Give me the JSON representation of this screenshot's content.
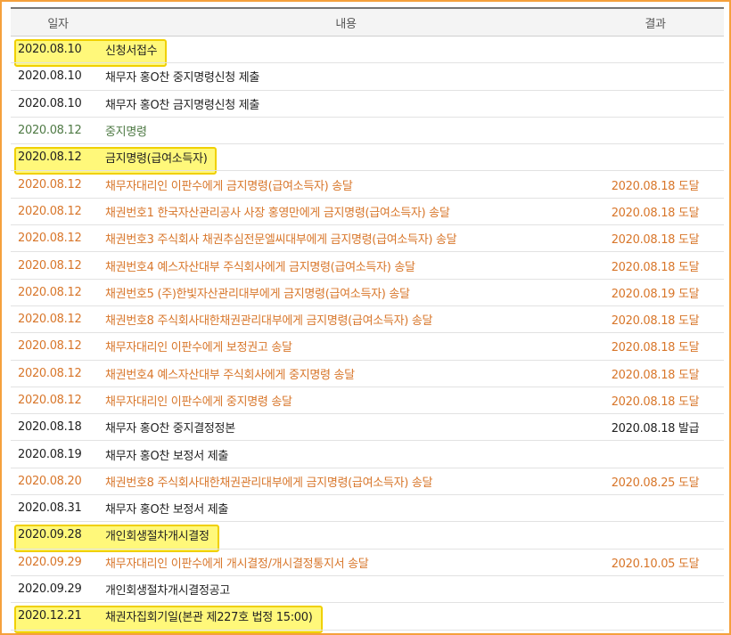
{
  "columns": {
    "date": "일자",
    "content": "내용",
    "result": "결과"
  },
  "rows": [
    {
      "date": "2020.08.10",
      "content": "신청서접수",
      "result": "",
      "style": "hl"
    },
    {
      "date": "2020.08.10",
      "content": "채무자 홍O찬 중지명령신청 제출",
      "result": "",
      "style": "black"
    },
    {
      "date": "2020.08.10",
      "content": "채무자 홍O찬 금지명령신청 제출",
      "result": "",
      "style": "black"
    },
    {
      "date": "2020.08.12",
      "content": "중지명령",
      "result": "",
      "style": "green"
    },
    {
      "date": "2020.08.12",
      "content": "금지명령(급여소득자)",
      "result": "",
      "style": "hl"
    },
    {
      "date": "2020.08.12",
      "content": "채무자대리인 이판수에게 금지명령(급여소득자) 송달",
      "result": "2020.08.18 도달",
      "style": "orange"
    },
    {
      "date": "2020.08.12",
      "content": "채권번호1 한국자산관리공사 사장 홍영만에게 금지명령(급여소득자) 송달",
      "result": "2020.08.18 도달",
      "style": "orange"
    },
    {
      "date": "2020.08.12",
      "content": "채권번호3 주식회사 채권추심전문엘씨대부에게 금지명령(급여소득자) 송달",
      "result": "2020.08.18 도달",
      "style": "orange"
    },
    {
      "date": "2020.08.12",
      "content": "채권번호4 예스자산대부 주식회사에게 금지명령(급여소득자) 송달",
      "result": "2020.08.18 도달",
      "style": "orange"
    },
    {
      "date": "2020.08.12",
      "content": "채권번호5 (주)한빛자산관리대부에게 금지명령(급여소득자) 송달",
      "result": "2020.08.19 도달",
      "style": "orange"
    },
    {
      "date": "2020.08.12",
      "content": "채권번호8 주식회사대한채권관리대부에게 금지명령(급여소득자) 송달",
      "result": "2020.08.18 도달",
      "style": "orange"
    },
    {
      "date": "2020.08.12",
      "content": "채무자대리인 이판수에게 보정권고 송달",
      "result": "2020.08.18 도달",
      "style": "orange"
    },
    {
      "date": "2020.08.12",
      "content": "채권번호4 예스자산대부 주식회사에게 중지명령 송달",
      "result": "2020.08.18 도달",
      "style": "orange"
    },
    {
      "date": "2020.08.12",
      "content": "채무자대리인 이판수에게 중지명령 송달",
      "result": "2020.08.18 도달",
      "style": "orange"
    },
    {
      "date": "2020.08.18",
      "content": "채무자 홍O찬 중지결정정본",
      "result": "2020.08.18 발급",
      "style": "black"
    },
    {
      "date": "2020.08.19",
      "content": "채무자 홍O찬 보정서 제출",
      "result": "",
      "style": "black"
    },
    {
      "date": "2020.08.20",
      "content": "채권번호8 주식회사대한채권관리대부에게 금지명령(급여소득자) 송달",
      "result": "2020.08.25 도달",
      "style": "orange"
    },
    {
      "date": "2020.08.31",
      "content": "채무자 홍O찬 보정서 제출",
      "result": "",
      "style": "black"
    },
    {
      "date": "2020.09.28",
      "content": "개인회생절차개시결정",
      "result": "",
      "style": "hl"
    },
    {
      "date": "2020.09.29",
      "content": "채무자대리인 이판수에게 개시결정/개시결정통지서 송달",
      "result": "2020.10.05 도달",
      "style": "orange"
    },
    {
      "date": "2020.09.29",
      "content": "개인회생절차개시결정공고",
      "result": "",
      "style": "black"
    },
    {
      "date": "2020.12.21",
      "content": "채권자집회기일(본관 제227호 법정 15:00)",
      "result": "",
      "style": "hl"
    }
  ],
  "colors": {
    "frame_border": "#f5a03c",
    "highlight_fill": "#fff87a",
    "highlight_border": "#f0d000",
    "orange_text": "#d8762a",
    "green_text": "#4f7a45",
    "black_text": "#222222"
  }
}
